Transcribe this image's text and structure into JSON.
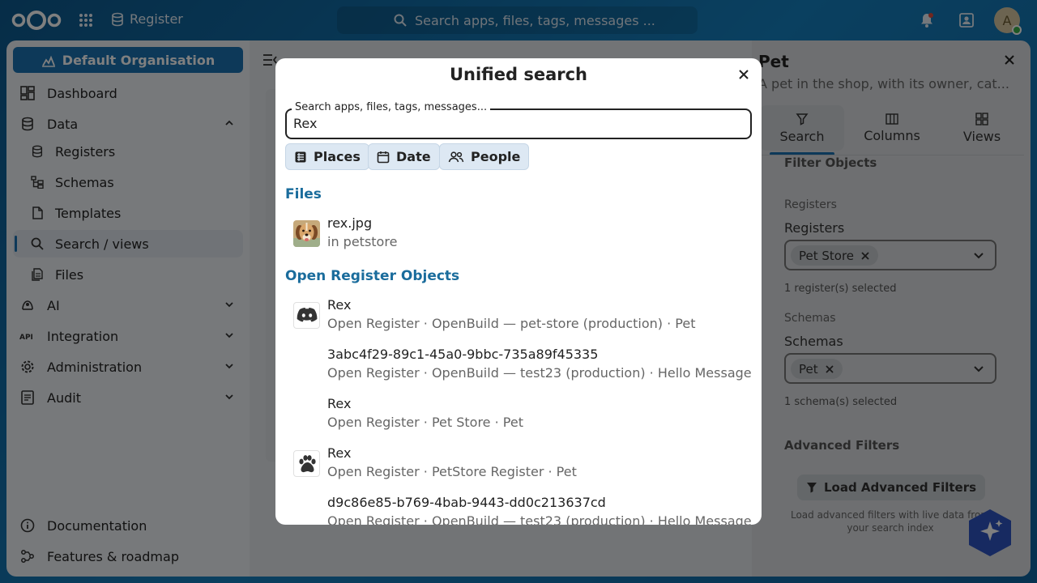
{
  "topbar": {
    "app_name": "Register",
    "search_placeholder": "Search apps, files, tags, messages ...",
    "avatar_initial": "A"
  },
  "sidebar": {
    "org_button": "Default Organisation",
    "items": [
      {
        "label": "Dashboard",
        "icon": "dashboard-icon"
      },
      {
        "label": "Data",
        "icon": "database-icon",
        "expanded": true
      },
      {
        "label": "Registers",
        "icon": "database-icon"
      },
      {
        "label": "Schemas",
        "icon": "schema-icon"
      },
      {
        "label": "Templates",
        "icon": "file-icon"
      },
      {
        "label": "Search / views",
        "icon": "search-icon",
        "active": true
      },
      {
        "label": "Files",
        "icon": "files-icon"
      },
      {
        "label": "AI",
        "icon": "ai-icon"
      },
      {
        "label": "Integration",
        "icon": "api-icon"
      },
      {
        "label": "Administration",
        "icon": "gear-icon"
      },
      {
        "label": "Audit",
        "icon": "audit-icon"
      }
    ],
    "footer": [
      {
        "label": "Documentation",
        "icon": "info-icon"
      },
      {
        "label": "Features & roadmap",
        "icon": "roadmap-icon"
      }
    ]
  },
  "right_panel": {
    "title": "Pet",
    "subtitle": "A pet in the shop, with its owner, cat...",
    "tabs": [
      "Search",
      "Columns",
      "Views"
    ],
    "section_filter_objects": "Filter Objects",
    "registers_small": "Registers",
    "registers_label": "Registers",
    "registers_chip": "Pet Store",
    "registers_hint": "1 register(s) selected",
    "schemas_small": "Schemas",
    "schemas_label": "Schemas",
    "schemas_chip": "Pet",
    "schemas_hint": "1 schema(s) selected",
    "advanced_filters": "Advanced Filters",
    "load_button": "Load Advanced Filters",
    "load_hint": "Load advanced filters with live data from your search index"
  },
  "modal": {
    "title": "Unified search",
    "field_legend": "Search apps, files, tags, messages...",
    "query": "Rex",
    "filters": [
      "Places",
      "Date",
      "People"
    ],
    "groups": [
      {
        "title": "Files",
        "results": [
          {
            "title": "rex.jpg",
            "subtitle": "in petstore",
            "thumb": "dog-photo"
          }
        ]
      },
      {
        "title": "Open Register Objects",
        "results": [
          {
            "title": "Rex",
            "subtitle": "Open Register · OpenBuild — pet-store (production) · Pet",
            "thumb": "discord-icon"
          },
          {
            "title": "3abc4f29-89c1-45a0-9bbc-735a89f45335",
            "subtitle": "Open Register · OpenBuild — test23 (production) · Hello Message",
            "thumb": ""
          },
          {
            "title": "Rex",
            "subtitle": "Open Register · Pet Store · Pet",
            "thumb": ""
          },
          {
            "title": "Rex",
            "subtitle": "Open Register · PetStore Register · Pet",
            "thumb": "paw-icon"
          },
          {
            "title": "d9c86e85-b769-4bab-9443-dd0c213637cd",
            "subtitle": "Open Register · OpenBuild — test23 (production) · Hello Message",
            "thumb": ""
          }
        ]
      }
    ]
  },
  "colors": {
    "brand": "#1a73b3",
    "group_title": "#1a6c9c",
    "filter_chip_bg": "#dde8f3"
  }
}
